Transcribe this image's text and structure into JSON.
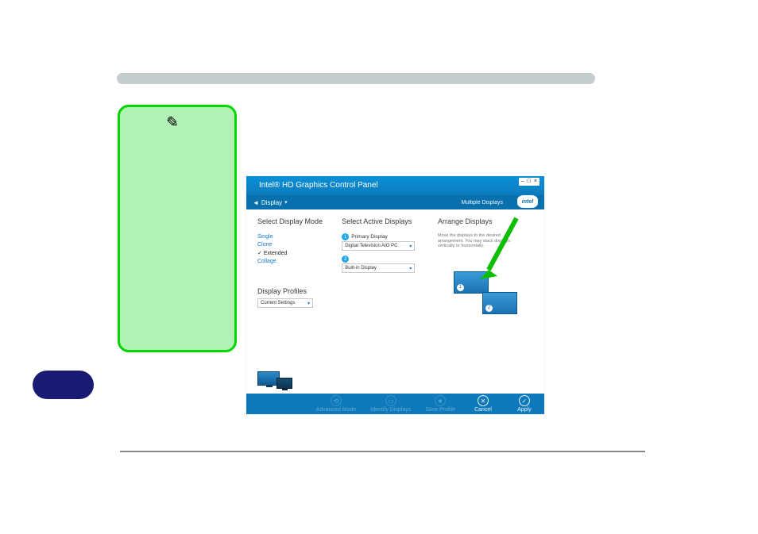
{
  "window": {
    "title": "Intel® HD Graphics Control Panel",
    "nav": {
      "back_label": "Display",
      "section": "Multiple Displays",
      "logo": "intel"
    },
    "win_controls": {
      "min": "–",
      "max": "□",
      "close": "×"
    }
  },
  "columns": {
    "mode": {
      "heading": "Select Display Mode",
      "items": [
        {
          "label": "Single",
          "selected": false
        },
        {
          "label": "Clone",
          "selected": false
        },
        {
          "label": "Extended",
          "selected": true
        },
        {
          "label": "Collage",
          "selected": false
        }
      ]
    },
    "active": {
      "heading": "Select Active Displays",
      "primary_label": "Primary Display",
      "primary_value": "Digital Television AIO PC",
      "secondary_num": "2",
      "secondary_value": "Built-in Display"
    },
    "arrange": {
      "heading": "Arrange Displays",
      "note": "Move the displays to the desired arrangement. You may stack displays vertically or horizontally.",
      "d1": "1",
      "d2": "2"
    }
  },
  "profiles": {
    "heading": "Display Profiles",
    "value": "Current Settings"
  },
  "footer": {
    "btn1": "Advanced Mode",
    "btn2": "Identify Displays",
    "btn3": "Save Profile",
    "cancel": "Cancel",
    "apply": "Apply"
  }
}
